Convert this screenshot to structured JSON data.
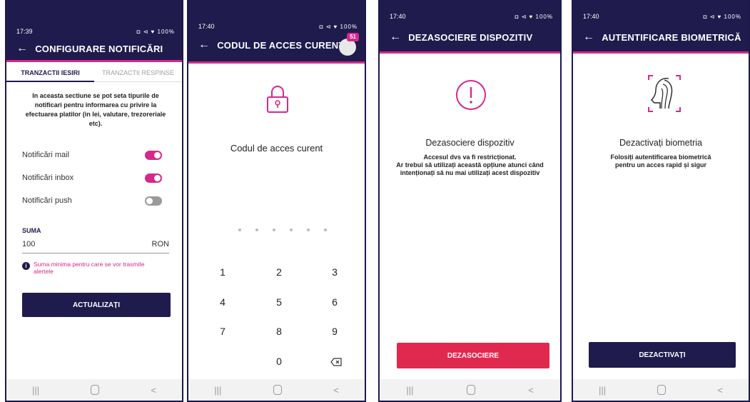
{
  "colors": {
    "primary": "#1f1b4d",
    "accent": "#d6288b",
    "danger": "#e1294f"
  },
  "screen1": {
    "time": "17:39",
    "status_right": "◘ ⊲ ♥ 100%",
    "title": "CONFIGURARE NOTIFICĂRI",
    "tab_active": "TRANZACTII IESIRI",
    "tab_inactive": "TRANZACTII RESPINSE",
    "intro": "In aceasta sectiune se pot seta tipurile de notificari pentru informarea cu privire la efectuarea platilor (in lei, valutare, trezoreriale etc).",
    "toggles": [
      {
        "label": "Notificări mail",
        "state": "on"
      },
      {
        "label": "Notificări inbox",
        "state": "on"
      },
      {
        "label": "Notificări push",
        "state": "off"
      }
    ],
    "sum_label": "SUMA",
    "sum_value": "100",
    "currency": "RON",
    "info_text": "Suma minima pentru care se vor trasmite alertele",
    "update_button": "ACTUALIZAȚI"
  },
  "screen2": {
    "time": "17:40",
    "status_right": "◘ ⊲ ♥ 100%",
    "title": "CODUL DE ACCES CURENT",
    "badge": "51",
    "prompt": "Codul de acces curent",
    "keys": [
      "1",
      "2",
      "3",
      "4",
      "5",
      "6",
      "7",
      "8",
      "9",
      "0"
    ]
  },
  "screen3": {
    "time": "17:40",
    "status_right": "◘ ⊲ ♥ 100%",
    "title": "DEZASOCIERE DISPOZITIV",
    "heading": "Dezasociere dispozitiv",
    "body": "Accesul dvs va fi restricționat.\nAr trebui să utilizați această opțiune atunci când intenționați să nu mai utilizați acest dispozitiv",
    "button": "DEZASOCIERE"
  },
  "screen4": {
    "time": "17:40",
    "status_right": "◘ ⊲ ♥ 100%",
    "title": "AUTENTIFICARE BIOMETRICĂ",
    "heading": "Dezactivați biometria",
    "body": "Folosiți autentificarea biometrică pentru un acces rapid și sigur",
    "button": "DEZACTIVAȚI"
  }
}
